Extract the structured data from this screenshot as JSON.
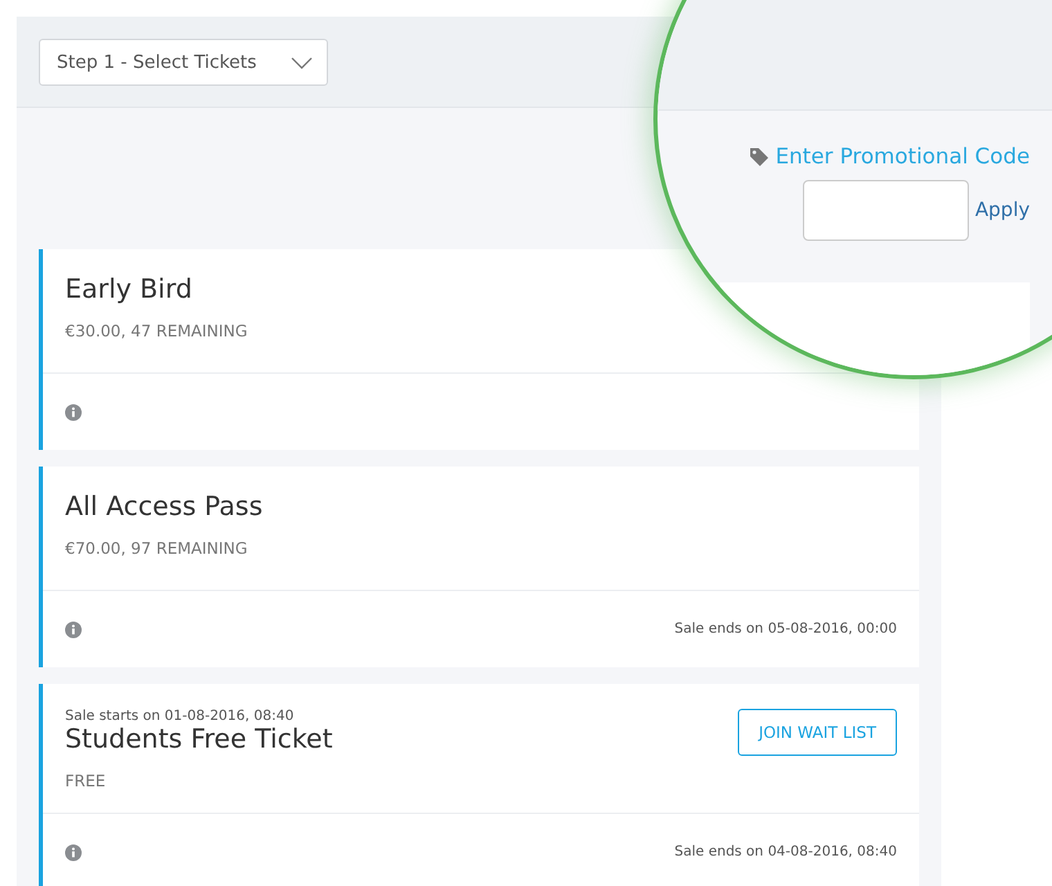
{
  "step_select": {
    "value": "Step 1 - Select Tickets"
  },
  "promo": {
    "link": "Enter Promotional Code",
    "apply": "Apply"
  },
  "tickets": [
    {
      "name": "Early Bird",
      "price": "€30.00, 47 REMAINING"
    },
    {
      "name": "All Access Pass",
      "price": "€70.00, 97 REMAINING",
      "sale_end": "Sale ends on 05-08-2016, 00:00"
    },
    {
      "name": "Students Free Ticket",
      "sale_start": "Sale starts on 01-08-2016, 08:40",
      "price": "FREE",
      "action": "JOIN WAIT LIST",
      "sale_end": "Sale ends on 04-08-2016, 08:40"
    }
  ]
}
